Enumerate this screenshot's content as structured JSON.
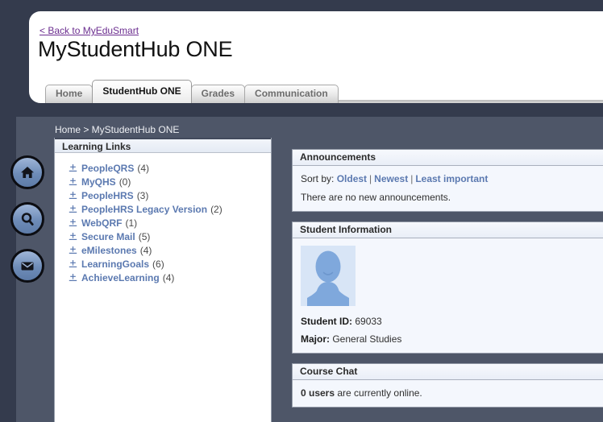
{
  "header": {
    "back_link": "< Back to MyEduSmart",
    "title": "MyStudentHub ONE"
  },
  "tabs": [
    {
      "label": "Home",
      "active": false
    },
    {
      "label": "StudentHub ONE",
      "active": true
    },
    {
      "label": "Grades",
      "active": false
    },
    {
      "label": "Communication",
      "active": false
    }
  ],
  "breadcrumb": "Home > MyStudentHub ONE",
  "rail_icons": [
    {
      "name": "home-icon"
    },
    {
      "name": "search-icon"
    },
    {
      "name": "mail-icon"
    }
  ],
  "learning_links": {
    "header": "Learning Links",
    "items": [
      {
        "label": "PeopleQRS",
        "count": "(4)"
      },
      {
        "label": "MyQHS",
        "count": "(0)"
      },
      {
        "label": "PeopleHRS",
        "count": "(3)"
      },
      {
        "label": "PeopleHRS Legacy Version",
        "count": "(2)"
      },
      {
        "label": "WebQRF",
        "count": "(1)"
      },
      {
        "label": "Secure Mail",
        "count": "(5)"
      },
      {
        "label": "eMilestones",
        "count": "(4)"
      },
      {
        "label": "LearningGoals",
        "count": "(6)"
      },
      {
        "label": "AchieveLearning",
        "count": "(4)"
      }
    ]
  },
  "announcements": {
    "header": "Announcements",
    "sort_label": "Sort by:",
    "sort_options": [
      "Oldest",
      "Newest",
      "Least important"
    ],
    "empty_text": "There are no new announcements."
  },
  "student_information": {
    "header": "Student Information",
    "student_id_label": "Student ID:",
    "student_id_value": "69033",
    "major_label": "Major:",
    "major_value": "General Studies"
  },
  "course_chat": {
    "header": "Course Chat",
    "user_count": "0 users",
    "status_text": "are currently online."
  },
  "colors": {
    "page_background": "#343b4d",
    "content_background": "#4e5668",
    "link_blue": "#5b79b0",
    "back_link_purple": "#6b2d8f",
    "panel_background": "#f2f6fd",
    "avatar_background": "#d8e5f6",
    "avatar_silhouette": "#7fa8dc"
  }
}
